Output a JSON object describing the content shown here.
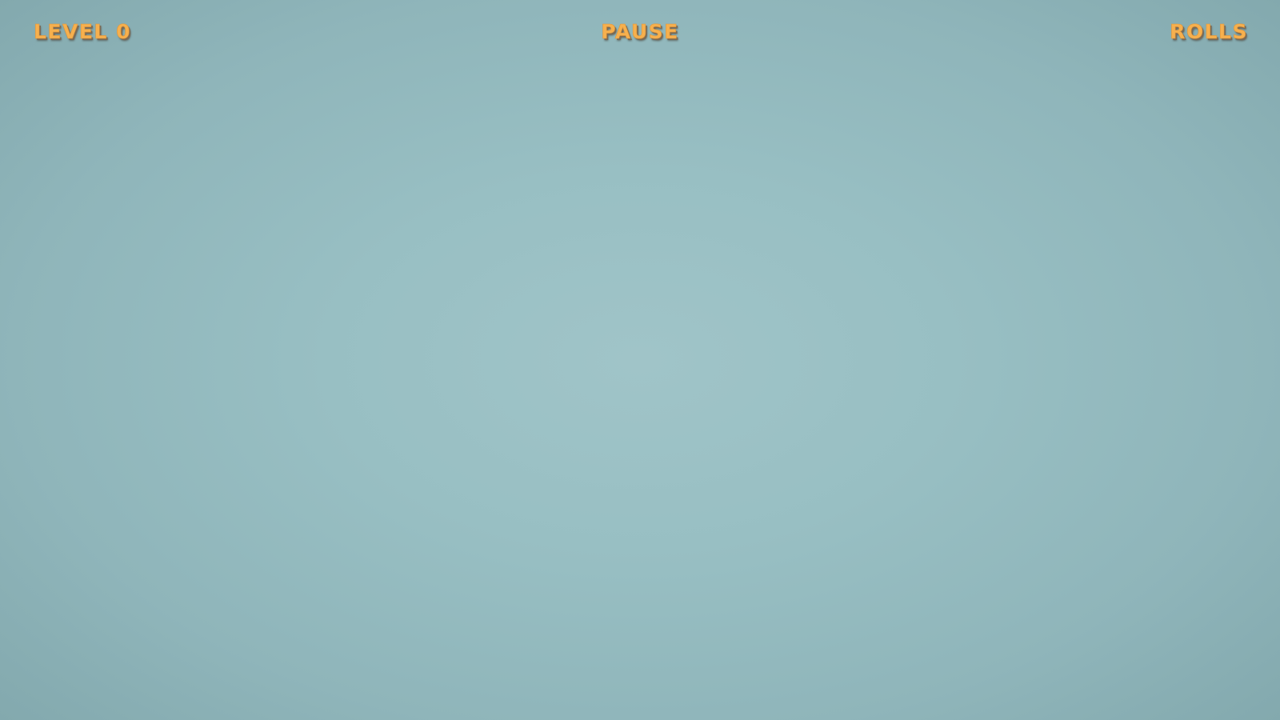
{
  "hud": {
    "level_label": "LEVEL 0",
    "pause_label": "PAUSE",
    "rolls_label": "ROLLS"
  },
  "colors": {
    "hud_text": "#f6b04e",
    "background_center": "#a0c4c8",
    "background_edge": "#82a8ad"
  }
}
